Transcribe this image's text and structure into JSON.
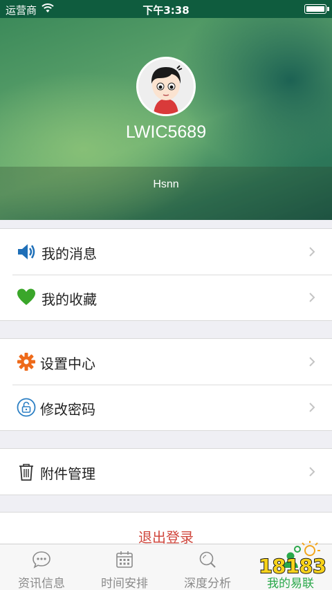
{
  "status_bar": {
    "carrier": "运营商",
    "time": "下午3:38"
  },
  "profile": {
    "username": "LWIC5689",
    "nickname": "Hsnn"
  },
  "menu_groups": [
    [
      {
        "label": "我的消息",
        "icon": "speaker-icon"
      },
      {
        "label": "我的收藏",
        "icon": "heart-icon"
      }
    ],
    [
      {
        "label": "设置中心",
        "icon": "gear-icon"
      },
      {
        "label": "修改密码",
        "icon": "lock-icon"
      }
    ],
    [
      {
        "label": "附件管理",
        "icon": "trash-icon"
      }
    ]
  ],
  "logout_label": "退出登录",
  "tabs": [
    {
      "label": "资讯信息",
      "icon": "chat-bubble-icon",
      "active": false
    },
    {
      "label": "时间安排",
      "icon": "calendar-icon",
      "active": false
    },
    {
      "label": "深度分析",
      "icon": "search-icon",
      "active": false
    },
    {
      "label": "我的易联",
      "icon": "person-icon",
      "active": true
    }
  ],
  "watermark": "18183",
  "colors": {
    "accent_green": "#2aa84a",
    "logout_red": "#d0463c",
    "speaker_blue": "#1e6fb8",
    "heart_green": "#3aa62a",
    "gear_orange": "#ee6a1a",
    "lock_blue": "#2b7fc4"
  }
}
